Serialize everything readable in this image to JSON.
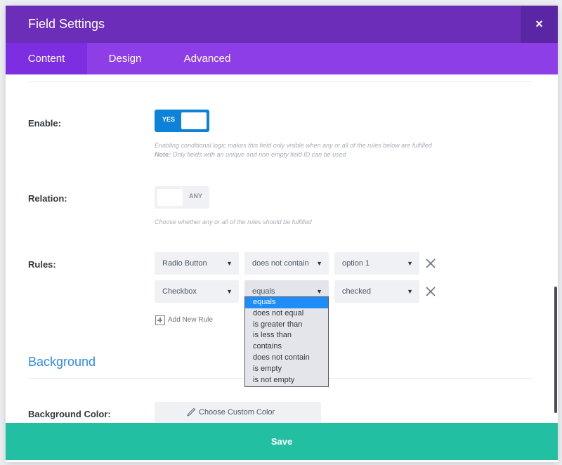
{
  "header": {
    "title": "Field Settings",
    "close_icon": "×"
  },
  "tabs": [
    {
      "label": "Content",
      "active": true
    },
    {
      "label": "Design",
      "active": false
    },
    {
      "label": "Advanced",
      "active": false
    }
  ],
  "enable": {
    "label": "Enable:",
    "toggle_text": "YES",
    "help_line1": "Enabling conditional logic makes this field only visible when any or all of the rules below are fulfilled",
    "help_note_bold": "Note:",
    "help_note_text": " Only fields with an unique and non-empty field ID can be used"
  },
  "relation": {
    "label": "Relation:",
    "toggle_text": "ANY",
    "help": "Choose whether any or all of the rules should be fulfilled"
  },
  "rules": {
    "label": "Rules:",
    "rows": [
      {
        "field": "Radio Button",
        "condition": "does not contain",
        "value": "option 1"
      },
      {
        "field": "Checkbox",
        "condition": "equals",
        "value": "checked"
      }
    ],
    "add_label": "Add New Rule",
    "condition_options": [
      "equals",
      "does not equal",
      "is greater than",
      "is less than",
      "contains",
      "does not contain",
      "is empty",
      "is not empty"
    ],
    "selected_option": "equals"
  },
  "background": {
    "section_title": "Background",
    "color_label": "Background Color:",
    "color_button": "Choose Custom Color"
  },
  "footer": {
    "save_label": "Save"
  },
  "colors": {
    "header": "#6c2eb9",
    "tabs": "#8d3ee7",
    "toggle_on": "#0c82d9",
    "accent": "#2e8be8",
    "save": "#22bfa3",
    "dropdown_highlight": "#1e8df7"
  }
}
